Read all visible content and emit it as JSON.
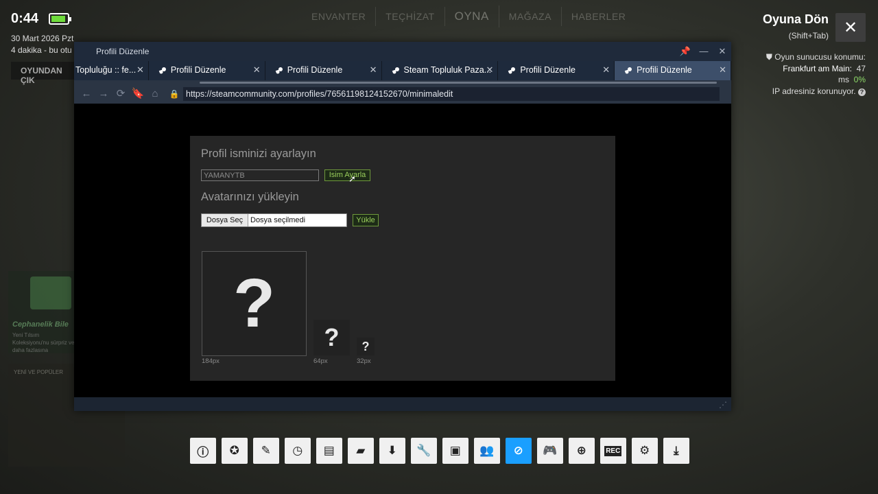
{
  "background": {
    "nav": [
      "ENVANTER",
      "TEÇHİZAT",
      "OYNA",
      "MAĞAZA",
      "HABERLER"
    ],
    "exit_button": "OYUNDAN ÇIK",
    "card_title": "Cephanelik Bile",
    "card_text": "Yeni Tılsım Koleksiyonu'nu sürpriz ve daha fazlasına",
    "card2_title": "YENİ VE POPÜLER"
  },
  "status": {
    "clock": "0:44",
    "battery_level": 0.9,
    "date": "30 Mart 2026 Pzt",
    "played": "4 dakika - bu otu"
  },
  "overlay": {
    "return_label": "Oyuna Dön",
    "return_shortcut": "(Shift+Tab)",
    "server_label": "Oyun sunucusu konumu:",
    "server_location": "Frankfurt am Main:",
    "ping": "47",
    "ping_unit": "ms",
    "loss": "0%",
    "ip_protected": "IP adresiniz korunuyor."
  },
  "browser": {
    "window_title": "Profili Düzenle",
    "tabs": [
      {
        "label": "Topluluğu :: fe..."
      },
      {
        "label": "Profili Düzenle"
      },
      {
        "label": "Profili Düzenle"
      },
      {
        "label": "Steam Topluluk Paza..."
      },
      {
        "label": "Profili Düzenle"
      },
      {
        "label": "Profili Düzenle"
      }
    ],
    "url": "https://steamcommunity.com/profiles/76561198124152670/minimaledit"
  },
  "profile_edit": {
    "name_heading": "Profil isminizi ayarlayın",
    "name_value": "YAMANYTB",
    "set_name_button": "Isim Ayarla",
    "avatar_heading": "Avatarınızı yükleyin",
    "choose_file_button": "Dosya Seç",
    "no_file_label": "Dosya seçilmedi",
    "upload_button": "Yükle",
    "avatar_sizes": [
      "184px",
      "64px",
      "32px"
    ],
    "placeholder_glyph": "?"
  },
  "dock": {
    "items": [
      "info-icon",
      "achievements-icon",
      "notes-icon",
      "timer-icon",
      "guides-icon",
      "chat-icon",
      "downloads-icon",
      "tools-icon",
      "screenshots-icon",
      "friends-icon",
      "browser-icon",
      "controller-icon",
      "web-icon",
      "recording-icon",
      "settings-icon",
      "collapse-icon"
    ],
    "recording_label": "REC",
    "active": "browser-icon"
  },
  "colors": {
    "accent_blue": "#1a9fff",
    "green_button": "#9bd05c",
    "battery_green": "#6fdc3c",
    "titlebar": "#1f2a3b",
    "active_tab": "#3d4f6a"
  }
}
